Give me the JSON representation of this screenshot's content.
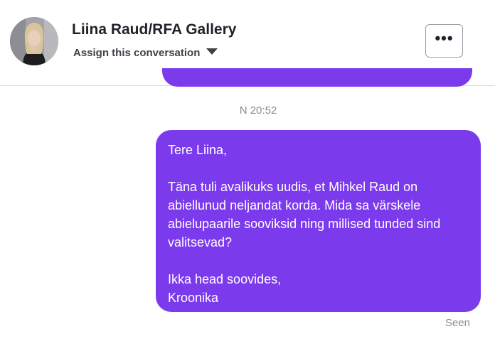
{
  "header": {
    "contact_name": "Liina Raud/RFA Gallery",
    "assign_label": "Assign this conversation",
    "more_label": "•••"
  },
  "thread": {
    "timestamp": "N 20:52",
    "message": {
      "text": "Tere Liina,\n\nTäna tuli avalikuks uudis, et Mihkel Raud on abiellunud neljandat korda. Mida sa värskele abielupaarile sooviksid ning millised tunded sind valitsevad?\n\nIkka head soovides,\nKroonika",
      "status": "Seen"
    }
  },
  "colors": {
    "bubble": "#7b3aec",
    "meta_text": "#888c93"
  }
}
